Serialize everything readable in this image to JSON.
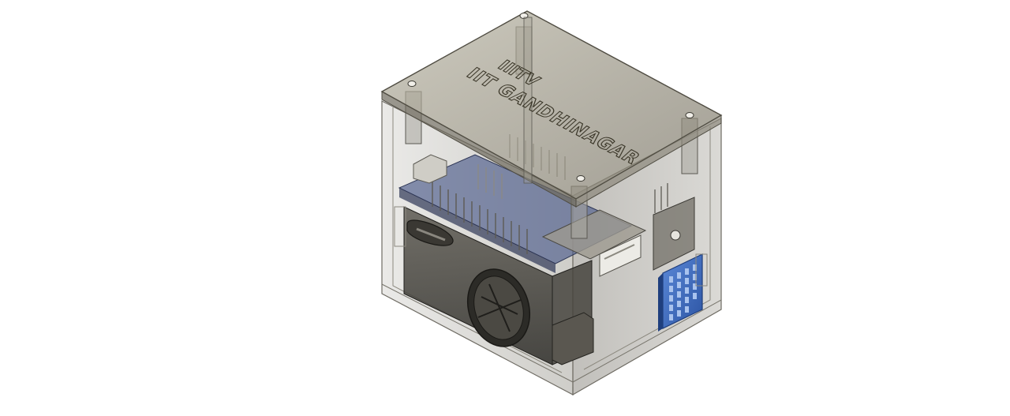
{
  "scene": {
    "subject": "3D CAD render of a transparent enclosure with electronics",
    "background_color": "#ffffff",
    "accent_sensor_color": "#3f6fc2",
    "pcb_color": "#4b5a8a",
    "shell_color": "#8a877d",
    "lid_color": "#6f6a55"
  },
  "lid": {
    "engraving_line1": "IIITV",
    "engraving_line2": "IIT GANDHINAGAR"
  }
}
